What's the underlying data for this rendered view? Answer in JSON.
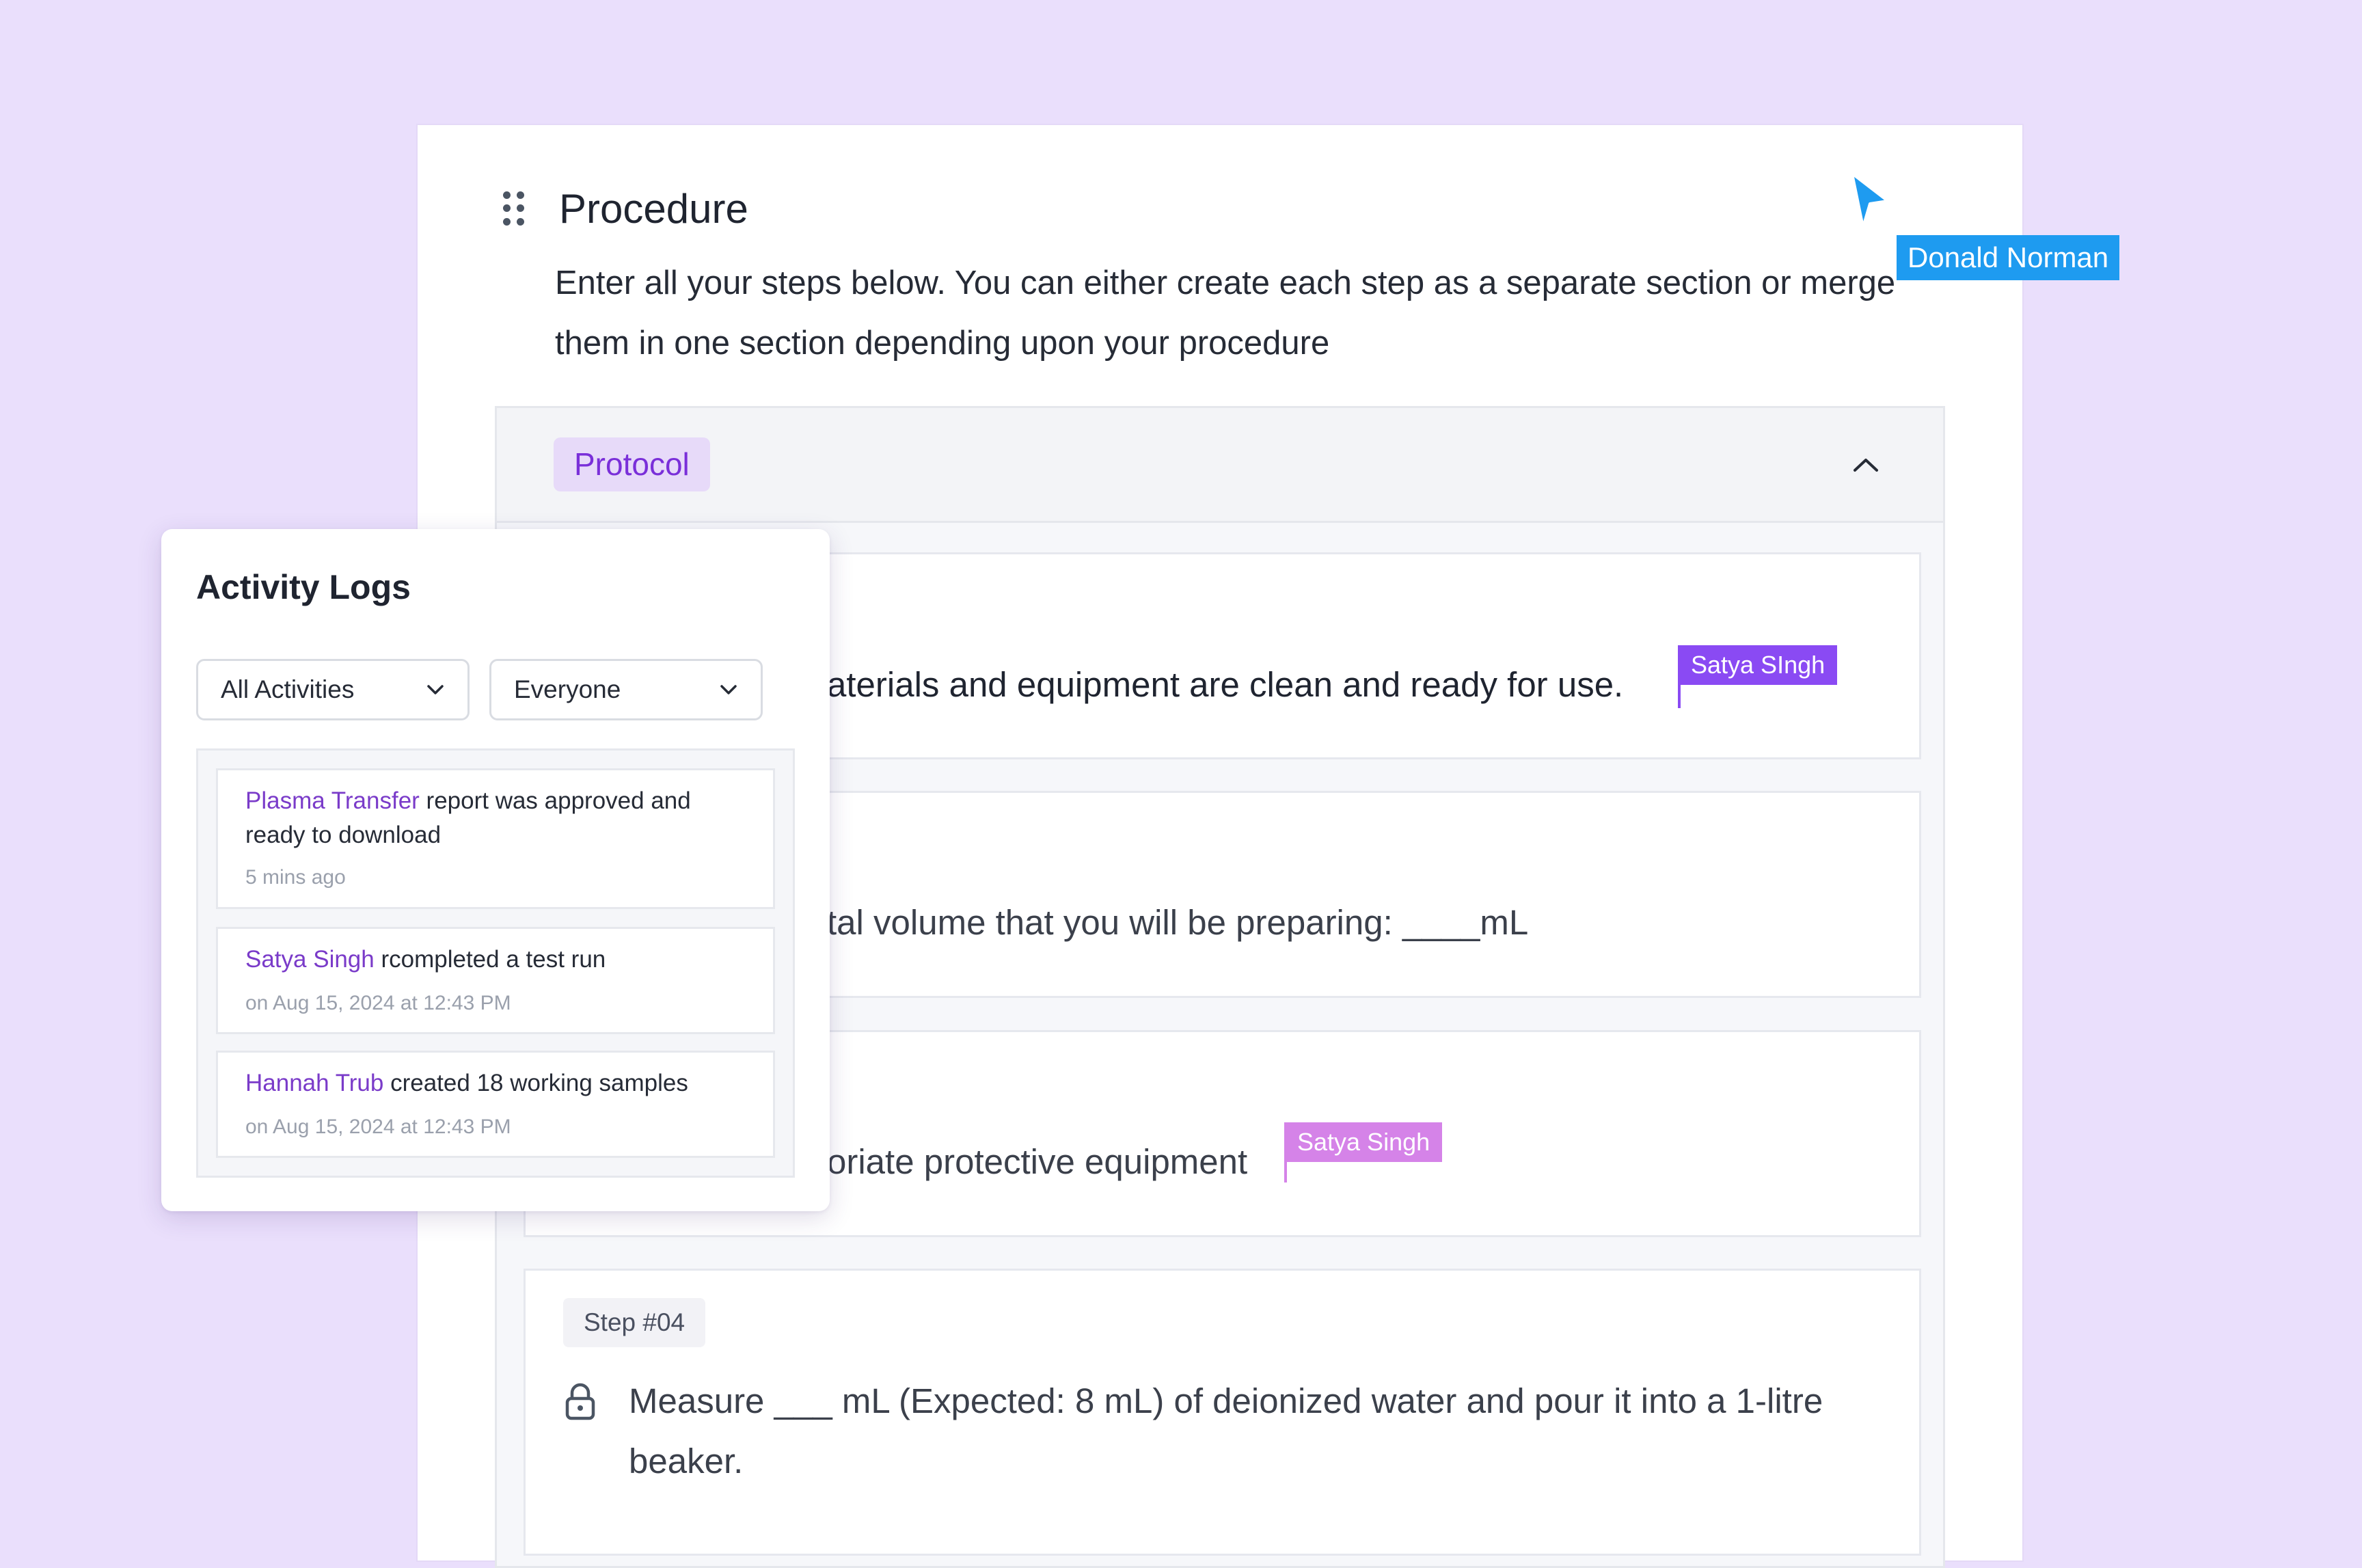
{
  "procedure": {
    "title": "Procedure",
    "description": "Enter all your steps below. You can either create each step as a separate section or merge them in one section depending upon your procedure"
  },
  "section": {
    "tag": "Protocol",
    "collapse_icon": "chevron-up-icon"
  },
  "steps": [
    {
      "text": "aterials and equipment are clean and ready for use."
    },
    {
      "text": "tal volume that you will be preparing: ____mL"
    },
    {
      "text": "oriate protective equipment"
    },
    {
      "label": "Step #04",
      "icon": "lock-icon",
      "text": "Measure ___ mL (Expected: 8 mL) of deionized water and pour it into a 1-litre beaker."
    }
  ],
  "collaborators": {
    "pointer_user": "Donald Norman",
    "cursor_1": "Satya SIngh",
    "cursor_2": "Satya Singh"
  },
  "colors": {
    "background": "#EADFFC",
    "accent": "#7A2FD9",
    "donald_badge": "#1E9BF0",
    "satya_caret_1": "#8A4AF3",
    "satya_caret_2": "#D583E8"
  },
  "activity_logs": {
    "title": "Activity Logs",
    "filter_type": "All Activities",
    "filter_people": "Everyone",
    "entries": [
      {
        "actor": "Plasma Transfer",
        "message": " report was approved and ready to download",
        "time": "5 mins ago"
      },
      {
        "actor": "Satya Singh",
        "message": " rcompleted a test run",
        "time": "on Aug 15, 2024 at 12:43 PM"
      },
      {
        "actor": "Hannah Trub",
        "message": " created 18 working samples",
        "time": "on Aug 15, 2024 at 12:43 PM"
      }
    ]
  }
}
